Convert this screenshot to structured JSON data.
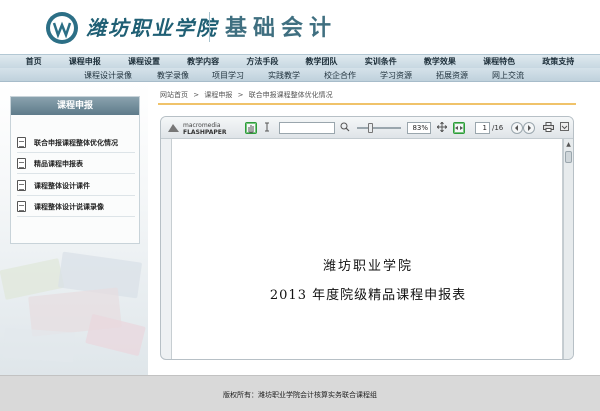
{
  "header": {
    "school_name": "潍坊职业学院",
    "course_name": "基础会计"
  },
  "main_nav": [
    "首页",
    "课程申报",
    "课程设置",
    "教学内容",
    "方法手段",
    "教学团队",
    "实训条件",
    "教学效果",
    "课程特色",
    "政策支持"
  ],
  "sub_nav": [
    "课程设计录像",
    "教学录像",
    "项目学习",
    "实践教学",
    "校企合作",
    "学习资源",
    "拓展资源",
    "网上交流"
  ],
  "sidebar": {
    "title": "课程申报",
    "items": [
      "联合申报课程整体优化情况",
      "精品课程申报表",
      "课程整体设计课件",
      "课程整体设计说课录像"
    ]
  },
  "breadcrumb": {
    "home": "网站首页",
    "sep1": ">",
    "section": "课程申报",
    "sep2": ">",
    "current": "联合申报课程整体优化情况"
  },
  "viewer": {
    "logo_top": "macromedia",
    "logo_bottom": "FLASHPAPER",
    "zoom": "83%",
    "page_current": "1",
    "page_total": "/16",
    "doc_line1": "潍坊职业学院",
    "doc_line2": "2013 年度院级精品课程申报表"
  },
  "footer": {
    "text": "版权所有：潍坊职业学院会计核算实务联合课程组"
  },
  "colors": {
    "brand_teal": "#1f5f74",
    "breadcrumb_rule": "#f0c36a",
    "active_tool": "#2d9c3a"
  }
}
